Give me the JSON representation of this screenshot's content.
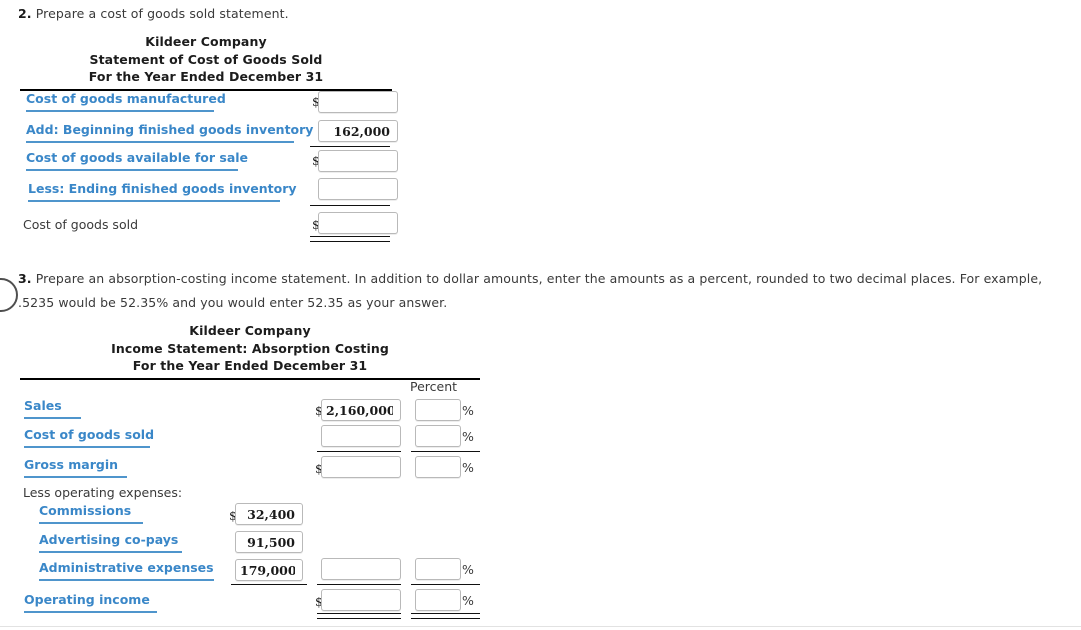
{
  "questions": [
    {
      "number": "2.",
      "text": "Prepare a cost of goods sold statement."
    },
    {
      "number": "3.",
      "text": "Prepare an absorption-costing income statement. In addition to dollar amounts, enter the amounts as a percent, rounded to two decimal places. For example, .5235 would be 52.35% and you would enter 52.35 as your answer."
    }
  ],
  "statement_cogs": {
    "title_line1": "Kildeer Company",
    "title_line2": "Statement of Cost of Goods Sold",
    "title_line3": "For the Year Ended December 31",
    "rows": [
      {
        "label": "Cost of goods manufactured",
        "style": "blue",
        "dollar": "$",
        "value": "",
        "placeholder": ""
      },
      {
        "label": "Add: Beginning finished goods inventory",
        "style": "blue",
        "dollar": "",
        "value": "162,000",
        "placeholder": ""
      },
      {
        "label": "Cost of goods available for sale",
        "style": "blue",
        "dollar": "$",
        "value": "",
        "placeholder": ""
      },
      {
        "label": "Less: Ending finished goods inventory",
        "style": "blue",
        "dollar": "",
        "value": "",
        "placeholder": ""
      },
      {
        "label": "Cost of goods sold",
        "style": "plain",
        "dollar": "$",
        "value": "",
        "placeholder": ""
      }
    ]
  },
  "statement_absorption": {
    "title_line1": "Kildeer Company",
    "title_line2": "Income Statement: Absorption Costing",
    "title_line3": "For the Year Ended December 31",
    "percent_header": "Percent",
    "percent_sign": "%",
    "section_label": "Less operating expenses:",
    "rows": [
      {
        "label": "Sales",
        "style": "blue",
        "dollar": "$",
        "value": "2,160,000",
        "percent": ""
      },
      {
        "label": "Cost of goods sold",
        "style": "blue",
        "dollar": "",
        "value": "",
        "percent": ""
      },
      {
        "label": "Gross margin",
        "style": "blue",
        "dollar": "$",
        "value": "",
        "percent": ""
      },
      {
        "label": "Commissions",
        "style": "blue",
        "dollar": "$",
        "value": "32,400",
        "percent": null
      },
      {
        "label": "Advertising co-pays",
        "style": "blue",
        "dollar": "",
        "value": "91,500",
        "percent": null
      },
      {
        "label": "Administrative expenses",
        "style": "blue",
        "dollar": "",
        "value": "179,000",
        "percent": ""
      },
      {
        "label": "Operating income",
        "style": "blue",
        "dollar": "$",
        "value": "",
        "percent": ""
      }
    ]
  },
  "colors": {
    "link_blue": "#3a87c8",
    "underline_blue": "#4f95cc",
    "rule_black": "#000000",
    "field_border": "#b9b9b9",
    "text": "#3a3a3a"
  }
}
